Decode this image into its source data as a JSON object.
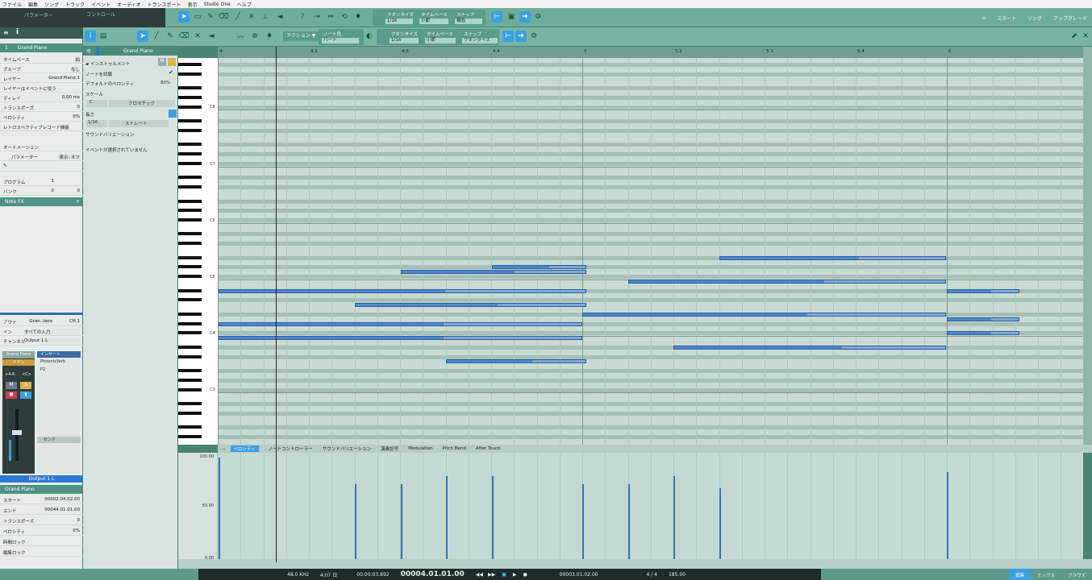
{
  "menu": [
    "ファイル",
    "編集",
    "ソング",
    "トラック",
    "イベント",
    "オーディオ",
    "トランスポート",
    "表示",
    "Studio One",
    "ヘルプ"
  ],
  "top_toolbar": {
    "parameter_label": "パラメーター",
    "control_label": "コントロール",
    "quantize_label": "クオンタイズ",
    "quantize_value": "1/16",
    "timebase_label": "タイムベース",
    "timebase_value": "小節",
    "snap_label": "スナップ",
    "snap_value": "構造",
    "start": "スタート",
    "song": "ソング",
    "upgrade": "アップグレード"
  },
  "left": {
    "track_title": "Grand Piano",
    "track_number": "1",
    "rows": [
      {
        "k": "タイムベース",
        "v": "拍"
      },
      {
        "k": "グループ",
        "v": "なし"
      },
      {
        "k": "レイヤー",
        "v": "Grand Piano 1"
      },
      {
        "k": "レイヤーはイベントに従う",
        "v": ""
      },
      {
        "k": "ディレイ",
        "v": "0.00 ms"
      },
      {
        "k": "トランスポーズ",
        "v": "0"
      },
      {
        "k": "ベロシティ",
        "v": "0%"
      },
      {
        "k": "レトロスペクティブレコード機能",
        "v": ""
      }
    ],
    "automation_label": "オートメーション",
    "param_label": "パラメーター",
    "param_value": "表示: オフ",
    "program_label": "プログラム",
    "program_value": "1",
    "bank_label": "バンク",
    "bank_value1": "0",
    "bank_value2": "0",
    "notefx": "Note FX",
    "out_label": "アウト",
    "out_value": "Gran..iano",
    "ch_value": "CH 1",
    "in_label": "イン",
    "in_value": "すべての入力",
    "channel_label": "チャンネル",
    "channel_value": "Output 1 L",
    "strip_name": "Grand Piano",
    "strip_main": "メイン",
    "strip_vol": "+4.6",
    "strip_pan": "<C>",
    "insert_label": "インサート",
    "insert1": "PhoenixVerb",
    "insert2": "P2",
    "send_label": "センド",
    "output_bar": "Output 1 L",
    "event_title": "Grand Piano",
    "event_rows": [
      {
        "k": "スタート",
        "v": "00002.04.02.00"
      },
      {
        "k": "エンド",
        "v": "00044.01.01.00"
      },
      {
        "k": "トランスポーズ",
        "v": "0"
      },
      {
        "k": "ベロシティ",
        "v": "0%"
      },
      {
        "k": "時間ロック",
        "v": ""
      },
      {
        "k": "編集ロック",
        "v": ""
      }
    ]
  },
  "editor": {
    "action": "アクション",
    "note_color_label": "ノート色",
    "note_color_value": "パート",
    "quantize_label": "クオンタイズ",
    "quantize_value": "1/16",
    "timebase_label": "タイムベース",
    "timebase_value": "小節",
    "snap_label": "スナップ",
    "snap_value": "クオンタイズ",
    "inspector_title": "Grand Piano",
    "instrument": "インストゥルメント",
    "listen": "ノートを試聴",
    "default_velocity": "デフォルトのベロシティ",
    "default_velocity_value": "80%",
    "scale": "スケール",
    "scale_root": "C",
    "scale_type": "クロマチック",
    "length": "長さ",
    "length_value": "1/16",
    "length_mode": "ストレート",
    "sound_variation": "サウンドバリエーション",
    "no_event": "イベントが選択されていません",
    "ruler": [
      "4",
      "4.2",
      "4.3",
      "4.4",
      "5",
      "5.2",
      "5.3",
      "5.4",
      "6"
    ],
    "octaves": [
      "C8",
      "C7",
      "C6",
      "C5",
      "C4",
      "C3",
      "C2",
      "C1"
    ],
    "tabs": [
      "ベロシティ",
      "ノートコントローラー",
      "サウンドバリエーション",
      "演奏記号",
      "Modulation",
      "Pitch Bend",
      "After Touch"
    ],
    "vel_scale": [
      "100.00",
      "50.00",
      "0.00"
    ]
  },
  "notes": [
    {
      "start": 0.377,
      "len": 0.633,
      "row": 52,
      "vel": 74
    },
    {
      "start": 0.502,
      "len": 0.508,
      "row": 45,
      "vel": 74
    },
    {
      "start": 0.627,
      "len": 0.383,
      "row": 64,
      "vel": 82
    },
    {
      "start": 0.752,
      "len": 0.258,
      "row": 44,
      "vel": 82
    },
    {
      "start": 0.002,
      "len": 1.008,
      "row": 49,
      "vel": 100
    },
    {
      "start": 0.002,
      "len": 0.998,
      "row": 56,
      "vel": 100
    },
    {
      "start": 0.002,
      "len": 0.998,
      "row": 59,
      "vel": 100
    },
    {
      "start": 1.0,
      "len": 0.998,
      "row": 54,
      "vel": 74
    },
    {
      "start": 1.125,
      "len": 0.873,
      "row": 47,
      "vel": 74
    },
    {
      "start": 1.25,
      "len": 0.748,
      "row": 61,
      "vel": 82
    },
    {
      "start": 1.375,
      "len": 0.623,
      "row": 42,
      "vel": 70
    },
    {
      "start": 2.0,
      "len": 0.2,
      "row": 49,
      "vel": 86
    },
    {
      "start": 2.0,
      "len": 0.2,
      "row": 55,
      "vel": 70
    },
    {
      "start": 2.0,
      "len": 0.2,
      "row": 58,
      "vel": 70
    }
  ],
  "transport": {
    "sample_rate": "48.0 KHz",
    "time": "4:07 日",
    "timecode": "00:00:03.892",
    "position": "00004.01.01.00",
    "left_loc": "00003.01.02.00",
    "signature": "4 / 4",
    "tempo": "185.00",
    "edit": "編集",
    "mix": "ミックス",
    "browse": "ブラウズ"
  }
}
